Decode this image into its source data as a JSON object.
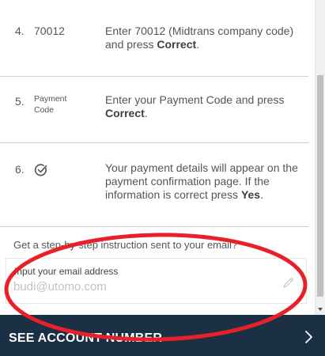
{
  "steps": [
    {
      "number": "4.",
      "code": "70012",
      "desc_prefix": "Enter 70012 (Midtrans company code) and press ",
      "desc_bold": "Correct",
      "desc_suffix": "."
    },
    {
      "number": "5.",
      "small_line1": "Payment",
      "small_line2": "Code",
      "desc_prefix": "Enter your Payment Code and press ",
      "desc_bold": "Correct",
      "desc_suffix": "."
    },
    {
      "number": "6.",
      "icon": "check-circle-icon",
      "desc_prefix": "Your payment details will appear on the payment confirmation page. If the information is correct press ",
      "desc_bold": "Yes",
      "desc_suffix": "."
    }
  ],
  "email_section": {
    "instruction": "Get a step-by-step instruction sent to your email?",
    "label": "Input your email address",
    "placeholder": "budi@utomo.com",
    "value": "",
    "icon": "pencil-icon"
  },
  "footer": {
    "label": "SEE ACCOUNT NUMBER",
    "icon": "chevron-right-icon",
    "background": "#1b2f45"
  },
  "annotation": {
    "color": "#e8202a",
    "shape": "ellipse"
  }
}
